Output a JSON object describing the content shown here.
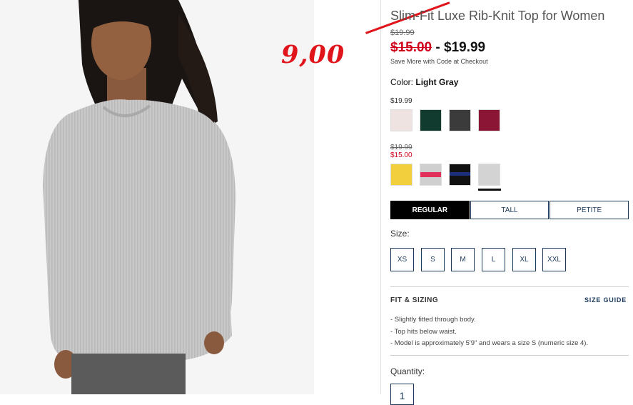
{
  "product": {
    "title": "Slim-Fit Luxe Rib-Knit Top for Women",
    "original_price": "$19.99",
    "sale_price": "$15.00",
    "price_separator": "-",
    "regular_price": "$19.99",
    "promo_text": "Save More with Code at Checkout"
  },
  "annotation": {
    "handwritten_price": "9,00",
    "color": "#e0141b"
  },
  "color_selector": {
    "label": "Color:",
    "selected": "Light Gray",
    "group1": {
      "price": "$19.99",
      "swatches": [
        {
          "name": "pale-pink",
          "color": "#efe3e2"
        },
        {
          "name": "dark-green",
          "color": "#123b2f"
        },
        {
          "name": "charcoal",
          "color": "#3b3b3b"
        },
        {
          "name": "burgundy",
          "color": "#8a1535"
        }
      ]
    },
    "group2": {
      "original_price": "$19.99",
      "sale_price": "$15.00",
      "swatches": [
        {
          "name": "yellow",
          "color": "#f2cf3d"
        },
        {
          "name": "gray-pink-stripe",
          "color": "#cfcfcf"
        },
        {
          "name": "black-navy-stripe",
          "color": "#111111"
        },
        {
          "name": "light-gray",
          "color": "#d3d3d3",
          "selected": true
        }
      ]
    }
  },
  "fit_tabs": [
    {
      "label": "REGULAR",
      "active": true
    },
    {
      "label": "TALL",
      "active": false
    },
    {
      "label": "PETITE",
      "active": false
    }
  ],
  "size_selector": {
    "label": "Size:",
    "options": [
      "XS",
      "S",
      "M",
      "L",
      "XL",
      "XXL"
    ]
  },
  "fit_sizing": {
    "heading": "FIT & SIZING",
    "guide_link": "SIZE GUIDE",
    "bullets": [
      "- Slightly fitted through body.",
      "- Top hits below waist.",
      "- Model is approximately 5'9\" and wears a size S (numeric size 4)."
    ]
  },
  "quantity": {
    "label": "Quantity:",
    "value": "1"
  },
  "colors": {
    "sale_red": "#d0021b",
    "navy": "#1b3a5c"
  }
}
